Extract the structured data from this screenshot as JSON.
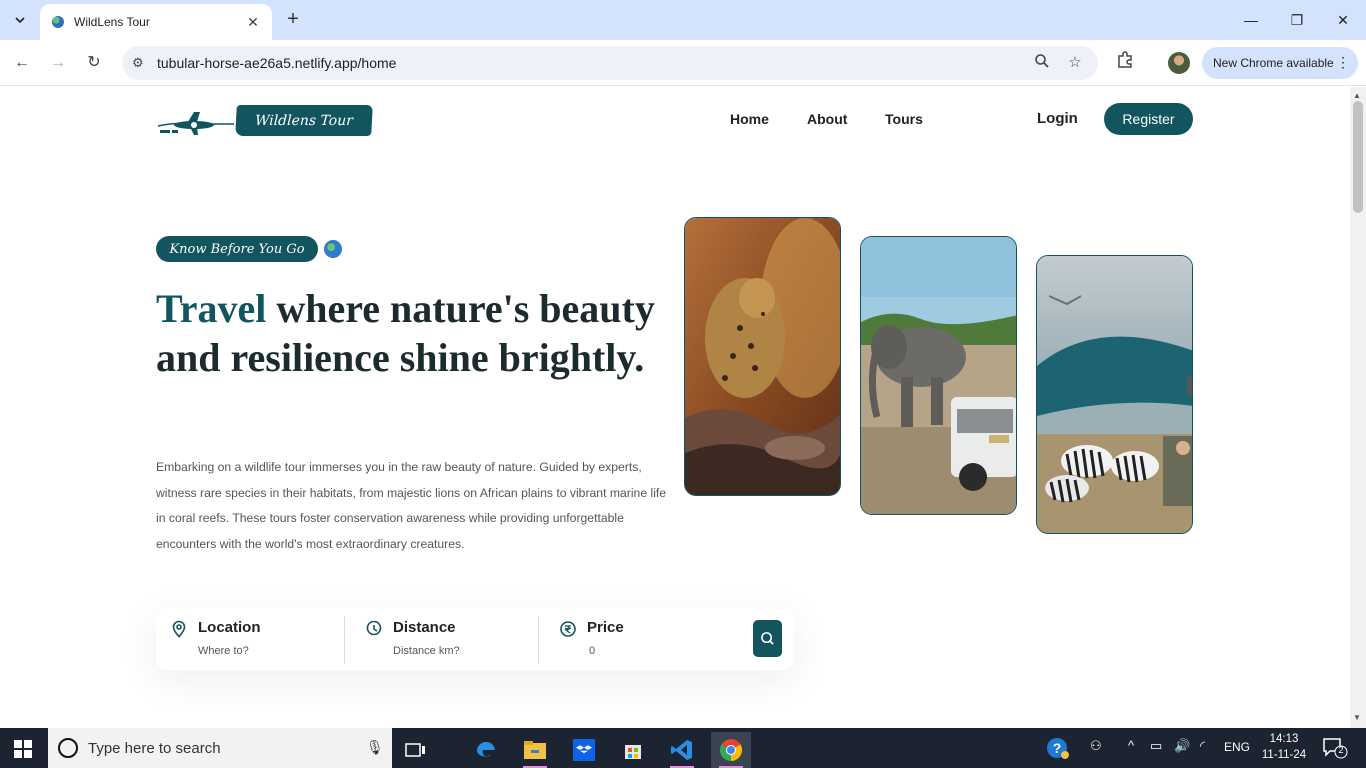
{
  "browser": {
    "tab_title": "WildLens Tour",
    "url": "tubular-horse-ae26a5.netlify.app/home",
    "update_label": "New Chrome available"
  },
  "site": {
    "logo_text": "Wildlens Tour",
    "nav": [
      {
        "label": "Home"
      },
      {
        "label": "About"
      },
      {
        "label": "Tours"
      }
    ],
    "login_label": "Login",
    "register_label": "Register"
  },
  "hero": {
    "badge": "Know Before You Go",
    "title_accent": "Travel",
    "title_rest": " where nature's beauty and resilience shine brightly.",
    "description": "Embarking on a wildlife tour immerses you in the raw beauty of nature. Guided by experts, witness rare species in their habitats, from majestic lions on African plains to vibrant marine life in coral reefs. These tours foster conservation awareness while providing unforgettable encounters with the world's most extraordinary creatures.",
    "photos": [
      "leopard",
      "elephant",
      "zebras"
    ]
  },
  "search": {
    "location": {
      "label": "Location",
      "placeholder": "Where to?"
    },
    "distance": {
      "label": "Distance",
      "placeholder": "Distance km?"
    },
    "price": {
      "label": "Price",
      "value": "0"
    }
  },
  "taskbar": {
    "search_placeholder": "Type here to search",
    "language": "ENG",
    "time": "14:13",
    "date": "11-11-24",
    "notification_count": "2"
  },
  "colors": {
    "accent": "#12555f",
    "chrome_frame": "#d3e3fd",
    "taskbar": "#1c2431"
  }
}
